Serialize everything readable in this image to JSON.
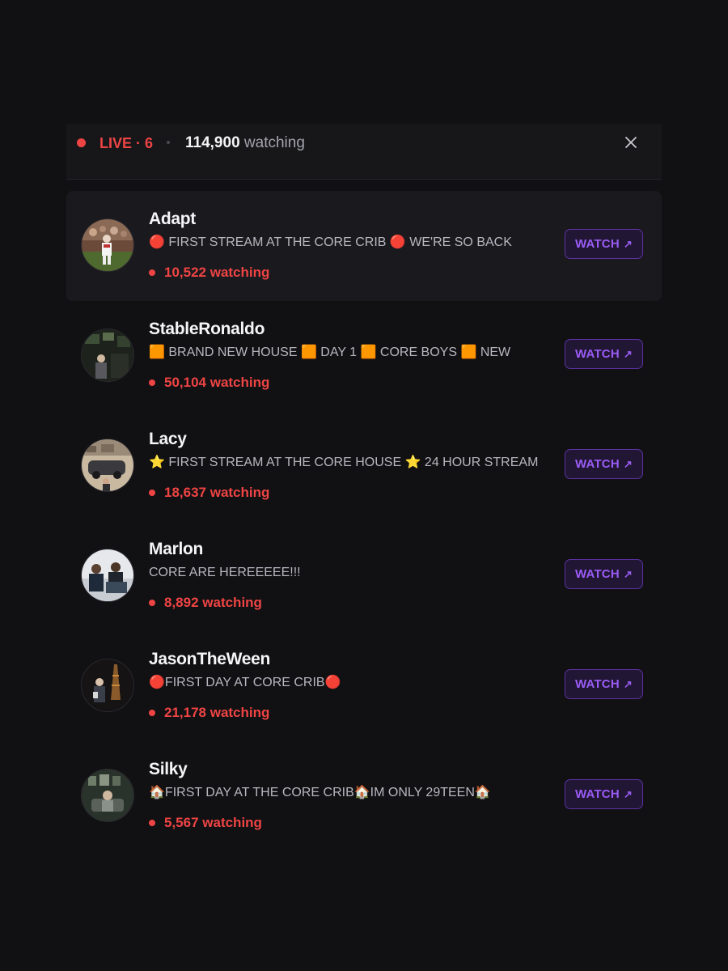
{
  "header": {
    "live_label": "LIVE · 6",
    "total_viewers": "114,900",
    "viewers_suffix": "watching",
    "close_icon": "close-icon"
  },
  "streams": [
    {
      "name": "Adapt",
      "title": "🔴 FIRST STREAM AT THE CORE CRIB 🔴 WE'RE SO BACK",
      "count": "10,522 watching",
      "watch": "WATCH",
      "arrow": "↗",
      "active": true
    },
    {
      "name": "StableRonaldo",
      "title": "🟧 BRAND NEW HOUSE 🟧 DAY 1 🟧 CORE BOYS 🟧 NEW",
      "count": "50,104 watching",
      "watch": "WATCH",
      "arrow": "↗",
      "active": false
    },
    {
      "name": "Lacy",
      "title": "⭐ FIRST STREAM AT THE CORE HOUSE ⭐ 24 HOUR STREAM",
      "count": "18,637 watching",
      "watch": "WATCH",
      "arrow": "↗",
      "active": false
    },
    {
      "name": "Marlon",
      "title": "CORE ARE HEREEEEE!!!",
      "count": "8,892 watching",
      "watch": "WATCH",
      "arrow": "↗",
      "active": false
    },
    {
      "name": "JasonTheWeen",
      "title": "🔴FIRST DAY AT CORE CRIB🔴",
      "count": "21,178 watching",
      "watch": "WATCH",
      "arrow": "↗",
      "active": false
    },
    {
      "name": "Silky",
      "title": "🏠FIRST DAY AT THE CORE CRIB🏠IM ONLY 29TEEN🏠",
      "count": "5,567 watching",
      "watch": "WATCH",
      "arrow": "↗",
      "active": false
    }
  ],
  "colors": {
    "accent_live": "#ef4444",
    "watch_border": "#5b32a3",
    "watch_text": "#9a5cf5",
    "background": "#111113"
  }
}
